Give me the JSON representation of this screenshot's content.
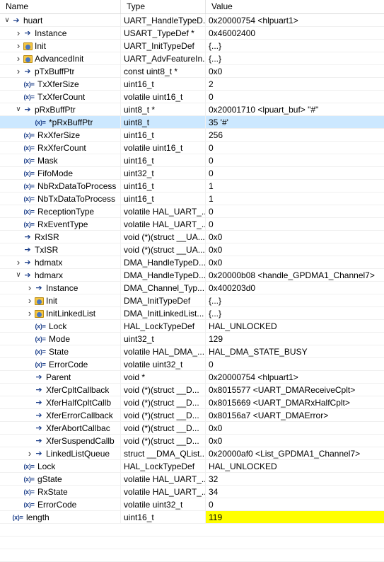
{
  "header": {
    "name": "Name",
    "type": "Type",
    "value": "Value"
  },
  "rows": [
    {
      "depth": 0,
      "tw": "expanded",
      "icon": "arrow",
      "name": "huart",
      "type": "UART_HandleTypeD...",
      "value": "0x20000754 <hlpuart1>"
    },
    {
      "depth": 1,
      "tw": "collapsed",
      "icon": "arrow",
      "name": "Instance",
      "type": "USART_TypeDef *",
      "value": "0x46002400"
    },
    {
      "depth": 1,
      "tw": "collapsed",
      "icon": "struct",
      "name": "Init",
      "type": "UART_InitTypeDef",
      "value": "{...}"
    },
    {
      "depth": 1,
      "tw": "collapsed",
      "icon": "struct",
      "name": "AdvancedInit",
      "type": "UART_AdvFeatureIn...",
      "value": "{...}"
    },
    {
      "depth": 1,
      "tw": "collapsed",
      "icon": "arrow",
      "name": "pTxBuffPtr",
      "type": "const uint8_t *",
      "value": "0x0"
    },
    {
      "depth": 1,
      "tw": "none",
      "icon": "x",
      "name": "TxXferSize",
      "type": "uint16_t",
      "value": "2"
    },
    {
      "depth": 1,
      "tw": "none",
      "icon": "x",
      "name": "TxXferCount",
      "type": "volatile uint16_t",
      "value": "0"
    },
    {
      "depth": 1,
      "tw": "expanded",
      "icon": "arrow",
      "name": "pRxBuffPtr",
      "type": "uint8_t *",
      "value": "0x20001710 <lpuart_buf> \"#\""
    },
    {
      "depth": 2,
      "tw": "none",
      "icon": "x",
      "name": "*pRxBuffPtr",
      "type": "uint8_t",
      "value": "35 '#'",
      "selected": true
    },
    {
      "depth": 1,
      "tw": "none",
      "icon": "x",
      "name": "RxXferSize",
      "type": "uint16_t",
      "value": "256"
    },
    {
      "depth": 1,
      "tw": "none",
      "icon": "x",
      "name": "RxXferCount",
      "type": "volatile uint16_t",
      "value": "0"
    },
    {
      "depth": 1,
      "tw": "none",
      "icon": "x",
      "name": "Mask",
      "type": "uint16_t",
      "value": "0"
    },
    {
      "depth": 1,
      "tw": "none",
      "icon": "x",
      "name": "FifoMode",
      "type": "uint32_t",
      "value": "0"
    },
    {
      "depth": 1,
      "tw": "none",
      "icon": "x",
      "name": "NbRxDataToProcess",
      "type": "uint16_t",
      "value": "1"
    },
    {
      "depth": 1,
      "tw": "none",
      "icon": "x",
      "name": "NbTxDataToProcess",
      "type": "uint16_t",
      "value": "1"
    },
    {
      "depth": 1,
      "tw": "none",
      "icon": "x",
      "name": "ReceptionType",
      "type": "volatile HAL_UART_...",
      "value": "0"
    },
    {
      "depth": 1,
      "tw": "none",
      "icon": "x",
      "name": "RxEventType",
      "type": "volatile HAL_UART_...",
      "value": "0"
    },
    {
      "depth": 1,
      "tw": "none",
      "icon": "arrow",
      "name": "RxISR",
      "type": "void (*)(struct __UA...",
      "value": "0x0"
    },
    {
      "depth": 1,
      "tw": "none",
      "icon": "arrow",
      "name": "TxISR",
      "type": "void (*)(struct __UA...",
      "value": "0x0"
    },
    {
      "depth": 1,
      "tw": "collapsed",
      "icon": "arrow",
      "name": "hdmatx",
      "type": "DMA_HandleTypeD...",
      "value": "0x0"
    },
    {
      "depth": 1,
      "tw": "expanded",
      "icon": "arrow",
      "name": "hdmarx",
      "type": "DMA_HandleTypeD...",
      "value": "0x20000b08 <handle_GPDMA1_Channel7>"
    },
    {
      "depth": 2,
      "tw": "collapsed",
      "icon": "arrow",
      "name": "Instance",
      "type": "DMA_Channel_Typ...",
      "value": "0x400203d0"
    },
    {
      "depth": 2,
      "tw": "collapsed",
      "icon": "struct",
      "name": "Init",
      "type": "DMA_InitTypeDef",
      "value": "{...}"
    },
    {
      "depth": 2,
      "tw": "collapsed",
      "icon": "struct",
      "name": "InitLinkedList",
      "type": "DMA_InitLinkedList...",
      "value": "{...}"
    },
    {
      "depth": 2,
      "tw": "none",
      "icon": "x",
      "name": "Lock",
      "type": "HAL_LockTypeDef",
      "value": "HAL_UNLOCKED"
    },
    {
      "depth": 2,
      "tw": "none",
      "icon": "x",
      "name": "Mode",
      "type": "uint32_t",
      "value": "129"
    },
    {
      "depth": 2,
      "tw": "none",
      "icon": "x",
      "name": "State",
      "type": "volatile HAL_DMA_...",
      "value": "HAL_DMA_STATE_BUSY"
    },
    {
      "depth": 2,
      "tw": "none",
      "icon": "x",
      "name": "ErrorCode",
      "type": "volatile uint32_t",
      "value": "0"
    },
    {
      "depth": 2,
      "tw": "none",
      "icon": "arrow",
      "name": "Parent",
      "type": "void *",
      "value": "0x20000754 <hlpuart1>"
    },
    {
      "depth": 2,
      "tw": "none",
      "icon": "arrow",
      "name": "XferCpltCallback",
      "type": "void (*)(struct __D...",
      "value": "0x8015577 <UART_DMAReceiveCplt>"
    },
    {
      "depth": 2,
      "tw": "none",
      "icon": "arrow",
      "name": "XferHalfCpltCallb",
      "type": "void (*)(struct __D...",
      "value": "0x8015669 <UART_DMARxHalfCplt>"
    },
    {
      "depth": 2,
      "tw": "none",
      "icon": "arrow",
      "name": "XferErrorCallback",
      "type": "void (*)(struct __D...",
      "value": "0x80156a7 <UART_DMAError>"
    },
    {
      "depth": 2,
      "tw": "none",
      "icon": "arrow",
      "name": "XferAbortCallbac",
      "type": "void (*)(struct __D...",
      "value": "0x0"
    },
    {
      "depth": 2,
      "tw": "none",
      "icon": "arrow",
      "name": "XferSuspendCallb",
      "type": "void (*)(struct __D...",
      "value": "0x0"
    },
    {
      "depth": 2,
      "tw": "collapsed",
      "icon": "arrow",
      "name": "LinkedListQueue",
      "type": "struct __DMA_QList...",
      "value": "0x20000af0 <List_GPDMA1_Channel7>"
    },
    {
      "depth": 1,
      "tw": "none",
      "icon": "x",
      "name": "Lock",
      "type": "HAL_LockTypeDef",
      "value": "HAL_UNLOCKED"
    },
    {
      "depth": 1,
      "tw": "none",
      "icon": "x",
      "name": "gState",
      "type": "volatile HAL_UART_...",
      "value": "32"
    },
    {
      "depth": 1,
      "tw": "none",
      "icon": "x",
      "name": "RxState",
      "type": "volatile HAL_UART_...",
      "value": "34"
    },
    {
      "depth": 1,
      "tw": "none",
      "icon": "x",
      "name": "ErrorCode",
      "type": "volatile uint32_t",
      "value": "0"
    },
    {
      "depth": 0,
      "tw": "none",
      "icon": "x",
      "name": "length",
      "type": "uint16_t",
      "value": "119",
      "highlight_value": true
    }
  ],
  "icons": {
    "x": "(x)=",
    "arrow": "➔"
  },
  "colors": {
    "selected_row": "#cce8ff",
    "changed_value": "#ffff00",
    "icon_blue": "#1c3f8a"
  }
}
